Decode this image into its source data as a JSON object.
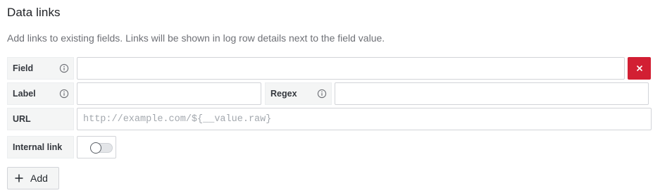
{
  "section": {
    "title": "Data links",
    "description": "Add links to existing fields. Links will be shown in log row details next to the field value."
  },
  "form": {
    "field_label": "Field",
    "field_value": "",
    "label_label": "Label",
    "label_value": "",
    "regex_label": "Regex",
    "regex_value": "",
    "url_label": "URL",
    "url_placeholder": "http://example.com/${__value.raw}",
    "internal_link_label": "Internal link",
    "internal_link_enabled": false
  },
  "actions": {
    "add_label": "Add"
  },
  "colors": {
    "delete_button": "#d21f33",
    "label_background": "#f4f5f5"
  },
  "icons": {
    "info": "info-circle-icon",
    "delete": "times-icon",
    "add": "plus-icon"
  }
}
